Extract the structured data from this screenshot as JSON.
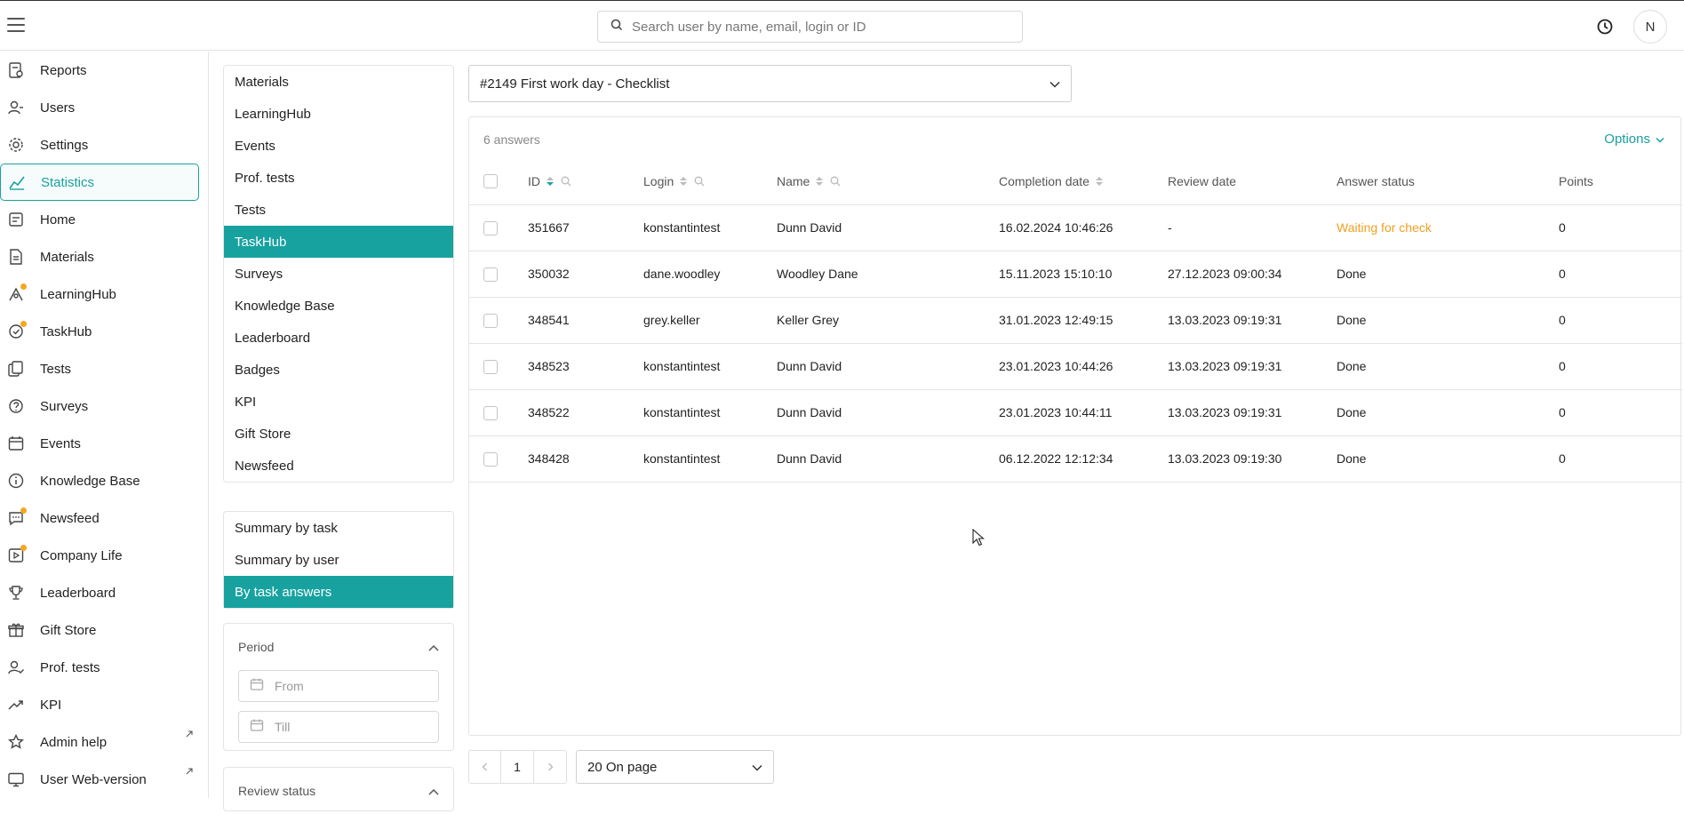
{
  "header": {
    "search_placeholder": "Search user by name, email, login or ID",
    "avatar_letter": "N"
  },
  "sidebar": {
    "items": [
      {
        "label": "Reports",
        "icon": "reports-icon",
        "dot": false
      },
      {
        "label": "Users",
        "icon": "users-icon",
        "dot": false
      },
      {
        "label": "Settings",
        "icon": "gear-icon",
        "dot": false
      },
      {
        "label": "Statistics",
        "icon": "chart-line-icon",
        "dot": false,
        "active": true
      },
      {
        "label": "Home",
        "icon": "home-icon",
        "dot": false
      },
      {
        "label": "Materials",
        "icon": "document-icon",
        "dot": false
      },
      {
        "label": "LearningHub",
        "icon": "learninghub-icon",
        "dot": true
      },
      {
        "label": "TaskHub",
        "icon": "taskhub-icon",
        "dot": true
      },
      {
        "label": "Tests",
        "icon": "tests-icon",
        "dot": false
      },
      {
        "label": "Surveys",
        "icon": "surveys-icon",
        "dot": false
      },
      {
        "label": "Events",
        "icon": "calendar-icon",
        "dot": false
      },
      {
        "label": "Knowledge Base",
        "icon": "info-icon",
        "dot": false
      },
      {
        "label": "Newsfeed",
        "icon": "newsfeed-icon",
        "dot": true
      },
      {
        "label": "Company Life",
        "icon": "play-icon",
        "dot": true
      },
      {
        "label": "Leaderboard",
        "icon": "trophy-icon",
        "dot": false
      },
      {
        "label": "Gift Store",
        "icon": "gift-icon",
        "dot": false
      },
      {
        "label": "Prof. tests",
        "icon": "user-check-icon",
        "dot": false
      },
      {
        "label": "KPI",
        "icon": "trend-icon",
        "dot": false
      },
      {
        "label": "Admin help",
        "icon": "star-icon",
        "dot": false,
        "external": true
      },
      {
        "label": "User Web-version",
        "icon": "monitor-icon",
        "dot": false,
        "external": true
      }
    ]
  },
  "stats_menu": {
    "items": [
      "Materials",
      "LearningHub",
      "Events",
      "Prof. tests",
      "Tests",
      "TaskHub",
      "Surveys",
      "Knowledge Base",
      "Leaderboard",
      "Badges",
      "KPI",
      "Gift Store",
      "Newsfeed"
    ],
    "active": "TaskHub"
  },
  "report_menu": {
    "items": [
      "Summary by task",
      "Summary by user",
      "By task answers"
    ],
    "active": "By task answers"
  },
  "filters": {
    "period_label": "Period",
    "from_placeholder": "From",
    "till_placeholder": "Till",
    "review_status_label": "Review status"
  },
  "task_selector": {
    "value": "#2149 First work day - Checklist"
  },
  "table": {
    "answers_count": "6 answers",
    "options_label": "Options",
    "columns": [
      "ID",
      "Login",
      "Name",
      "Completion date",
      "Review date",
      "Answer status",
      "Points"
    ],
    "rows": [
      {
        "id": "351667",
        "login": "konstantintest",
        "name": "Dunn David",
        "completion": "16.02.2024 10:46:26",
        "review": "-",
        "status": "Waiting for check",
        "points": "0"
      },
      {
        "id": "350032",
        "login": "dane.woodley",
        "name": "Woodley Dane",
        "completion": "15.11.2023 15:10:10",
        "review": "27.12.2023 09:00:34",
        "status": "Done",
        "points": "0"
      },
      {
        "id": "348541",
        "login": "grey.keller",
        "name": "Keller Grey",
        "completion": "31.01.2023 12:49:15",
        "review": "13.03.2023 09:19:31",
        "status": "Done",
        "points": "0"
      },
      {
        "id": "348523",
        "login": "konstantintest",
        "name": "Dunn David",
        "completion": "23.01.2023 10:44:26",
        "review": "13.03.2023 09:19:31",
        "status": "Done",
        "points": "0"
      },
      {
        "id": "348522",
        "login": "konstantintest",
        "name": "Dunn David",
        "completion": "23.01.2023 10:44:11",
        "review": "13.03.2023 09:19:31",
        "status": "Done",
        "points": "0"
      },
      {
        "id": "348428",
        "login": "konstantintest",
        "name": "Dunn David",
        "completion": "06.12.2022 12:12:34",
        "review": "13.03.2023 09:19:30",
        "status": "Done",
        "points": "0"
      }
    ]
  },
  "pagination": {
    "current_page": "1",
    "per_page": "20 On page"
  },
  "colors": {
    "accent": "#17a2a0",
    "waiting": "#f0a020",
    "dot": "#f5a623"
  }
}
